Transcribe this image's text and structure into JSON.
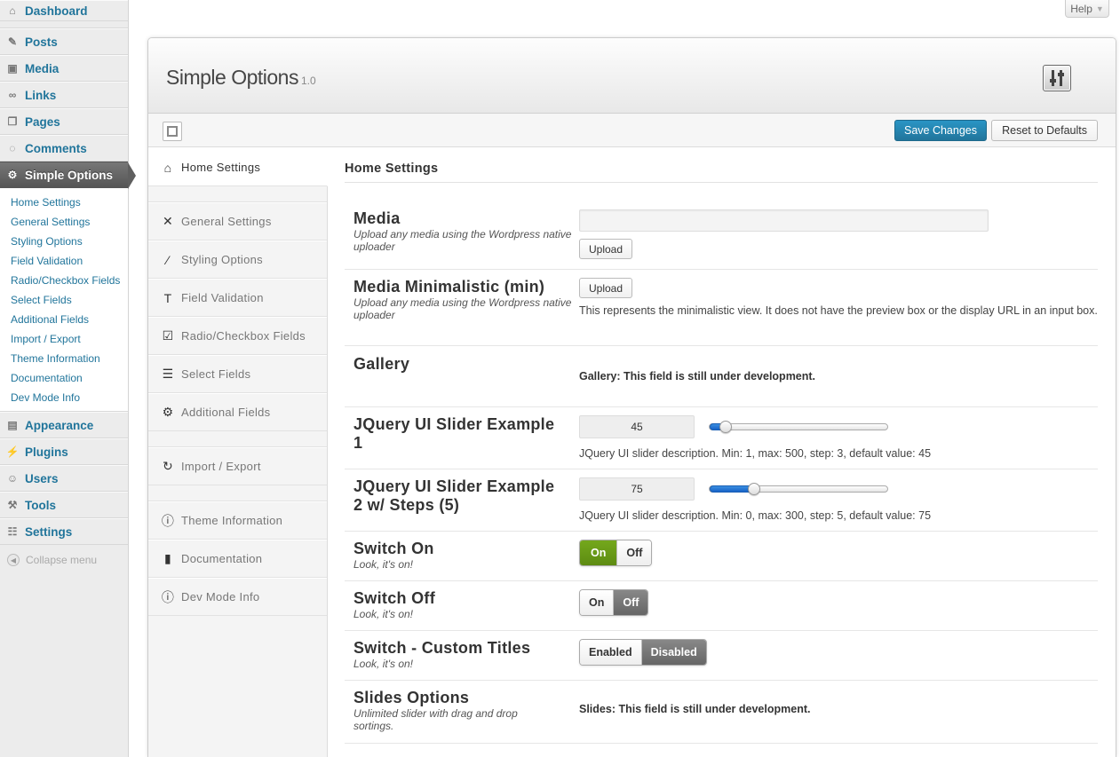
{
  "adminmenu": {
    "dashboard": "Dashboard",
    "posts": "Posts",
    "media": "Media",
    "links": "Links",
    "pages": "Pages",
    "comments": "Comments",
    "simple_options": "Simple Options",
    "submenu": [
      "Home Settings",
      "General Settings",
      "Styling Options",
      "Field Validation",
      "Radio/Checkbox Fields",
      "Select Fields",
      "Additional Fields",
      "Import / Export",
      "Theme Information",
      "Documentation",
      "Dev Mode Info"
    ],
    "appearance": "Appearance",
    "plugins": "Plugins",
    "users": "Users",
    "tools": "Tools",
    "settings": "Settings",
    "collapse": "Collapse menu"
  },
  "help": {
    "label": "Help"
  },
  "panel": {
    "title": "Simple Options",
    "version": "1.0",
    "save_label": "Save Changes",
    "reset_label": "Reset to Defaults"
  },
  "nav": {
    "home": "Home Settings",
    "general": "General Settings",
    "styling": "Styling Options",
    "validation": "Field Validation",
    "radio": "Radio/Checkbox Fields",
    "select": "Select Fields",
    "additional": "Additional Fields",
    "import": "Import / Export",
    "theme": "Theme Information",
    "docs": "Documentation",
    "dev": "Dev Mode Info"
  },
  "content": {
    "section_title": "Home Settings",
    "media": {
      "label": "Media",
      "desc": "Upload any media using the Wordpress native uploader",
      "upload": "Upload"
    },
    "media_min": {
      "label": "Media Minimalistic (min)",
      "desc": "Upload any media using the Wordpress native uploader",
      "upload": "Upload",
      "note": "This represents the minimalistic view. It does not have the preview box or the display URL in an input box."
    },
    "gallery": {
      "label": "Gallery",
      "note": "Gallery: This field is still under development."
    },
    "slider1": {
      "label": "JQuery UI Slider Example 1",
      "value": "45",
      "fraction": 0.088,
      "desc": "JQuery UI slider description. Min: 1, max: 500, step: 3, default value: 45"
    },
    "slider2": {
      "label": "JQuery UI Slider Example 2 w/ Steps (5)",
      "value": "75",
      "fraction": 0.25,
      "desc": "JQuery UI slider description. Min: 0, max: 300, step: 5, default value: 75"
    },
    "switch_on": {
      "label": "Switch On",
      "desc": "Look, it's on!",
      "on": "On",
      "off": "Off"
    },
    "switch_off": {
      "label": "Switch Off",
      "desc": "Look, it's on!",
      "on": "On",
      "off": "Off"
    },
    "switch_custom": {
      "label": "Switch - Custom Titles",
      "desc": "Look, it's on!",
      "on": "Enabled",
      "off": "Disabled"
    },
    "slides": {
      "label": "Slides Options",
      "desc": "Unlimited slider with drag and drop sortings.",
      "note": "Slides: This field is still under development."
    }
  }
}
